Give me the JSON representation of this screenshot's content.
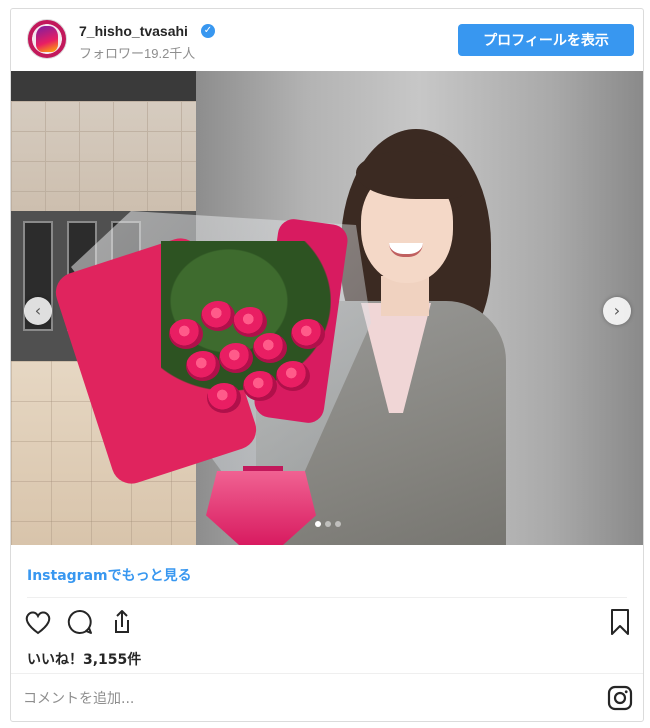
{
  "header": {
    "username": "7_hisho_tvasahi",
    "followers": "フォロワー19.2千人",
    "profile_button": "プロフィールを表示"
  },
  "photo": {
    "carousel_total": 3,
    "carousel_index": 1
  },
  "footer": {
    "more_link": "Instagramでもっと見る",
    "likes": "いいね！3,155件",
    "comment_placeholder": "コメントを追加..."
  },
  "icons": {
    "verified": "verified-badge-icon",
    "like": "heart-icon",
    "comment": "comment-bubble-icon",
    "share": "share-icon",
    "save": "bookmark-icon",
    "instagram": "instagram-logo-icon",
    "prev": "chevron-left-icon",
    "next": "chevron-right-icon"
  },
  "colors": {
    "accent": "#3897f0",
    "text": "#262626",
    "muted": "#8e8e8e",
    "border": "#dbdbdb"
  }
}
